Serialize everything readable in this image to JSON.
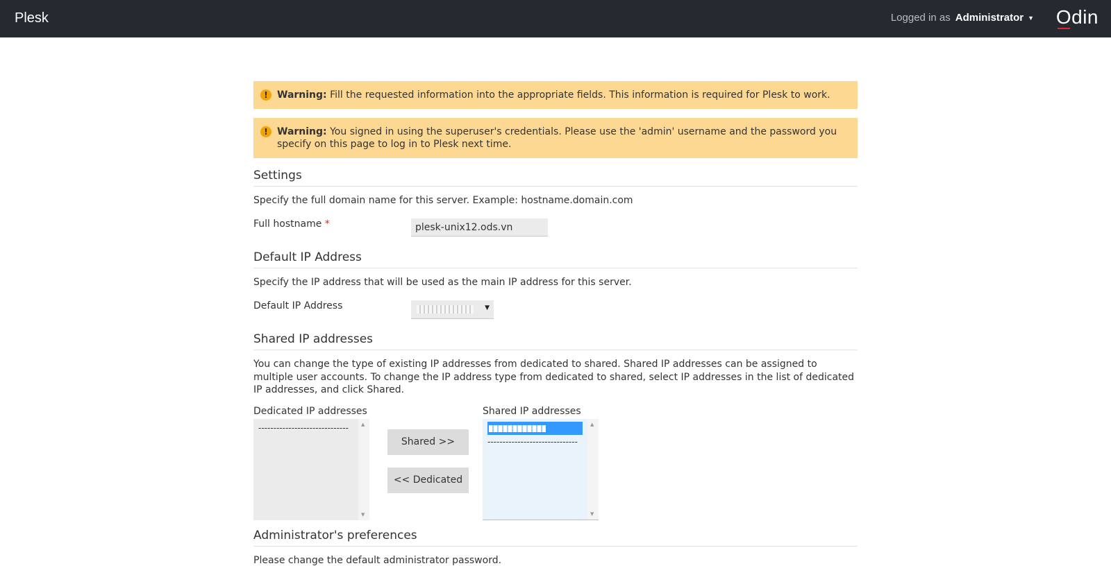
{
  "header": {
    "brand": "Plesk",
    "logged_in_prefix": "Logged in as",
    "username": "Administrator",
    "vendor_logo": "Odin"
  },
  "messages": [
    {
      "title": "Warning:",
      "text": "Fill the requested information into the appropriate fields. This information is required for Plesk to work."
    },
    {
      "title": "Warning:",
      "text": "You signed in using the superuser's credentials. Please use the 'admin' username and the password you specify on this page to log in to Plesk next time."
    }
  ],
  "settings": {
    "title": "Settings",
    "hint": "Specify the full domain name for this server. Example: hostname.domain.com",
    "hostname_label": "Full hostname",
    "required_mark": "*",
    "hostname_value": "plesk-unix12.ods.vn"
  },
  "default_ip": {
    "title": "Default IP Address",
    "hint": "Specify the IP address that will be used as the main IP address for this server.",
    "label": "Default IP Address",
    "arrow": "▼"
  },
  "shared_ip": {
    "title": "Shared IP addresses",
    "hint": "You can change the type of existing IP addresses from dedicated to shared. Shared IP addresses can be assigned to multiple user accounts. To change the IP address type from dedicated to shared, select IP addresses in the list of dedicated IP addresses, and click Shared.",
    "dedicated_label": "Dedicated IP addresses",
    "dedicated_items": [
      "------------------------------"
    ],
    "shared_label": "Shared IP addresses",
    "shared_separator": "------------------------------",
    "to_shared_button": "Shared >>",
    "to_dedicated_button": "<< Dedicated"
  },
  "admin_prefs": {
    "title": "Administrator's preferences",
    "hint": "Please change the default administrator password."
  },
  "icons": {
    "warning": "warning-icon",
    "caret": "chevron-down-icon",
    "scroll_up": "scroll-up-icon",
    "scroll_down": "scroll-down-icon"
  },
  "colors": {
    "topbar": "#252a30",
    "warning_bg": "#fdd893",
    "warning_icon": "#f0a30a",
    "selection": "#3399ff",
    "required": "#d02b2b"
  }
}
